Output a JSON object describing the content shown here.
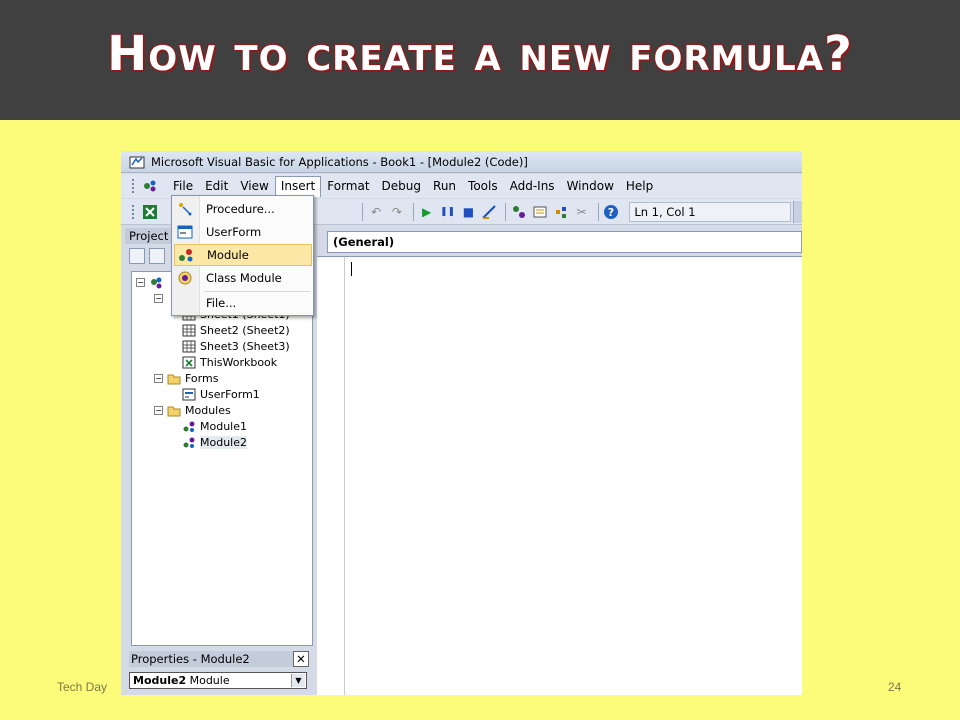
{
  "slide": {
    "title": "How to create a new formula?",
    "footer_left": "Tech Day",
    "page_number": "24"
  },
  "window": {
    "title": "Microsoft Visual Basic for Applications - Book1 - [Module2 (Code)]"
  },
  "menu": {
    "items": [
      "File",
      "Edit",
      "View",
      "Insert",
      "Format",
      "Debug",
      "Run",
      "Tools",
      "Add-Ins",
      "Window",
      "Help"
    ],
    "active": "Insert"
  },
  "insert_menu": {
    "items": [
      {
        "label": "Procedure...",
        "icon": "procedure-icon"
      },
      {
        "label": "UserForm",
        "icon": "userform-icon"
      },
      {
        "label": "Module",
        "icon": "module-icon",
        "highlighted": true
      },
      {
        "label": "Class Module",
        "icon": "class-module-icon"
      },
      {
        "label": "File...",
        "icon": ""
      }
    ]
  },
  "toolbar": {
    "status": "Ln 1, Col 1",
    "icons": [
      "excel-icon",
      "undo-icon",
      "redo-icon",
      "run-icon",
      "pause-icon",
      "stop-icon",
      "design-mode-icon",
      "project-explorer-icon",
      "properties-icon",
      "object-browser-icon",
      "toolbox-icon",
      "help-icon"
    ]
  },
  "project_panel": {
    "caption": "Project",
    "tree": [
      {
        "label": "Sheet1 (Sheet1)",
        "level": 2,
        "icon": "sheet-icon"
      },
      {
        "label": "Sheet2 (Sheet2)",
        "level": 2,
        "icon": "sheet-icon"
      },
      {
        "label": "Sheet3 (Sheet3)",
        "level": 2,
        "icon": "sheet-icon"
      },
      {
        "label": "ThisWorkbook",
        "level": 2,
        "icon": "workbook-icon"
      },
      {
        "label": "Forms",
        "level": 1,
        "icon": "folder-icon",
        "expander": "−"
      },
      {
        "label": "UserForm1",
        "level": 2,
        "icon": "userform-icon"
      },
      {
        "label": "Modules",
        "level": 1,
        "icon": "folder-icon",
        "expander": "−"
      },
      {
        "label": "Module1",
        "level": 2,
        "icon": "module-icon"
      },
      {
        "label": "Module2",
        "level": 2,
        "icon": "module-icon",
        "selected": true
      }
    ]
  },
  "properties_panel": {
    "caption": "Properties - Module2",
    "close": "✕",
    "object_name": "Module2",
    "object_type": "Module"
  },
  "code_window": {
    "general": "(General)"
  },
  "colors": {
    "slide_background": "#fdfb7a",
    "header_background": "#404040",
    "title_outline": "#8a1c1c",
    "menu_highlight": "#fbe8a6"
  }
}
